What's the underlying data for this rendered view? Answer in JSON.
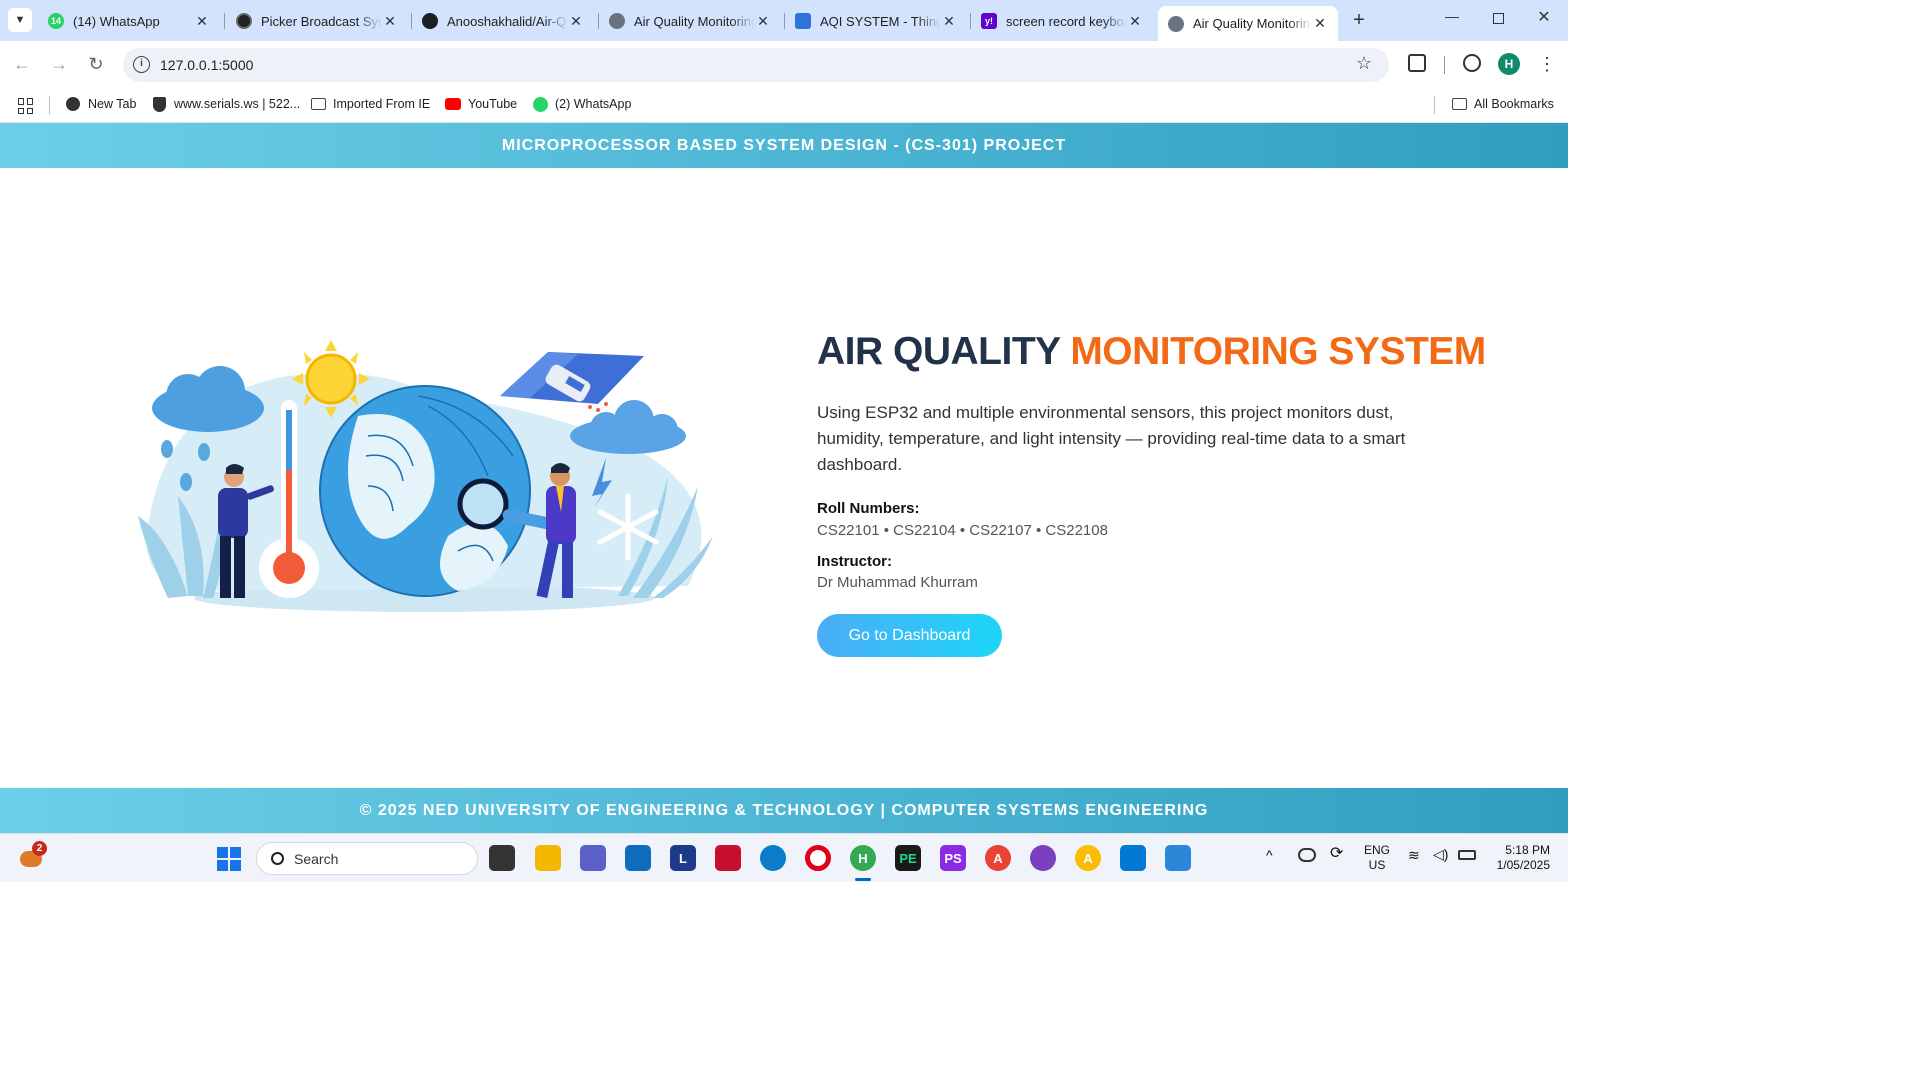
{
  "browser": {
    "tabs": [
      {
        "title": "(14) WhatsApp",
        "icon": "whatsapp-icon"
      },
      {
        "title": "Picker Broadcast Sync",
        "icon": "openai-icon"
      },
      {
        "title": "Anooshakhalid/Air-Q",
        "icon": "github-icon"
      },
      {
        "title": "Air Quality Monitoring",
        "icon": "globe-icon"
      },
      {
        "title": "AQI SYSTEM - Things",
        "icon": "chat-icon"
      },
      {
        "title": "screen record keyboard",
        "icon": "yahoo-icon"
      },
      {
        "title": "Air Quality Monitoring",
        "icon": "globe-icon",
        "active": true
      }
    ],
    "url": "127.0.0.1:5000",
    "profile_initial": "H",
    "whatsapp_badge": "14",
    "bookmarks": [
      {
        "label": "New Tab",
        "icon": "globe-icon"
      },
      {
        "label": "www.serials.ws | 522...",
        "icon": "shield-icon"
      },
      {
        "label": "Imported From IE",
        "icon": "folder-icon"
      },
      {
        "label": "YouTube",
        "icon": "youtube-icon"
      },
      {
        "label": "(2) WhatsApp",
        "icon": "whatsapp-icon"
      }
    ],
    "all_bookmarks": "All Bookmarks"
  },
  "page": {
    "header": "MICROPROCESSOR BASED SYSTEM DESIGN - (CS-301) PROJECT",
    "title_main": "AIR QUALITY",
    "title_accent": "MONITORING SYSTEM",
    "description": "Using ESP32 and multiple environmental sensors, this project monitors dust, humidity, temperature, and light intensity — providing real-time data to a smart dashboard.",
    "roll_label": "Roll Numbers:",
    "roll_numbers": "CS22101 • CS22104 • CS22107 • CS22108",
    "instructor_label": "Instructor:",
    "instructor": "Dr Muhammad Khurram",
    "cta": "Go to Dashboard",
    "footer": "© 2025 NED UNIVERSITY OF ENGINEERING & TECHNOLOGY | COMPUTER SYSTEMS ENGINEERING"
  },
  "colors": {
    "accent": "#f26a16",
    "title": "#223349",
    "header_start": "#6ccfe9",
    "header_end": "#2f9ec0"
  },
  "taskbar": {
    "search_placeholder": "Search",
    "weather_badge": "2",
    "language": "ENG",
    "region": "US",
    "time": "5:18 PM",
    "date": "1/05/2025",
    "letter_app": "L",
    "pycharm_label": "PE",
    "phpstorm_label": "PS",
    "chrome_profile_h": "H",
    "chrome_profile_a1": "A",
    "chrome_profile_a2": "A"
  }
}
